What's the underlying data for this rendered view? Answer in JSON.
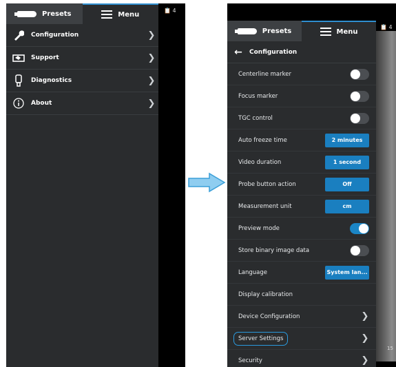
{
  "left": {
    "tabs": {
      "presets": "Presets",
      "menu": "Menu"
    },
    "scanner_badge": "4",
    "items": [
      {
        "label": "Configuration",
        "icon": "wrench-icon"
      },
      {
        "label": "Support",
        "icon": "support-icon"
      },
      {
        "label": "Diagnostics",
        "icon": "probe-outline-icon"
      },
      {
        "label": "About",
        "icon": "info-icon"
      }
    ]
  },
  "right": {
    "tabs": {
      "presets": "Presets",
      "menu": "Menu"
    },
    "scanner_badge": "4",
    "back_title": "Configuration",
    "rows": [
      {
        "label": "Centerline marker",
        "type": "toggle",
        "on": false
      },
      {
        "label": "Focus marker",
        "type": "toggle",
        "on": false
      },
      {
        "label": "TGC control",
        "type": "toggle",
        "on": false
      },
      {
        "label": "Auto freeze time",
        "type": "value",
        "value": "2 minutes"
      },
      {
        "label": "Video duration",
        "type": "value",
        "value": "1 second"
      },
      {
        "label": "Probe button action",
        "type": "value",
        "value": "Off"
      },
      {
        "label": "Measurement unit",
        "type": "value",
        "value": "cm"
      },
      {
        "label": "Preview mode",
        "type": "toggle",
        "on": true
      },
      {
        "label": "Store binary image data",
        "type": "toggle",
        "on": false
      },
      {
        "label": "Language",
        "type": "value",
        "value": "System lan..."
      },
      {
        "label": "Display calibration",
        "type": "none"
      },
      {
        "label": "Device Configuration",
        "type": "chevron"
      },
      {
        "label": "Server Settings",
        "type": "chevron",
        "highlighted": true
      },
      {
        "label": "Security",
        "type": "chevron"
      }
    ],
    "bottom_text": "15"
  },
  "colors": {
    "panel": "#2a2c2e",
    "accent": "#1a7fc0",
    "arrow": "#5ab0e0"
  }
}
